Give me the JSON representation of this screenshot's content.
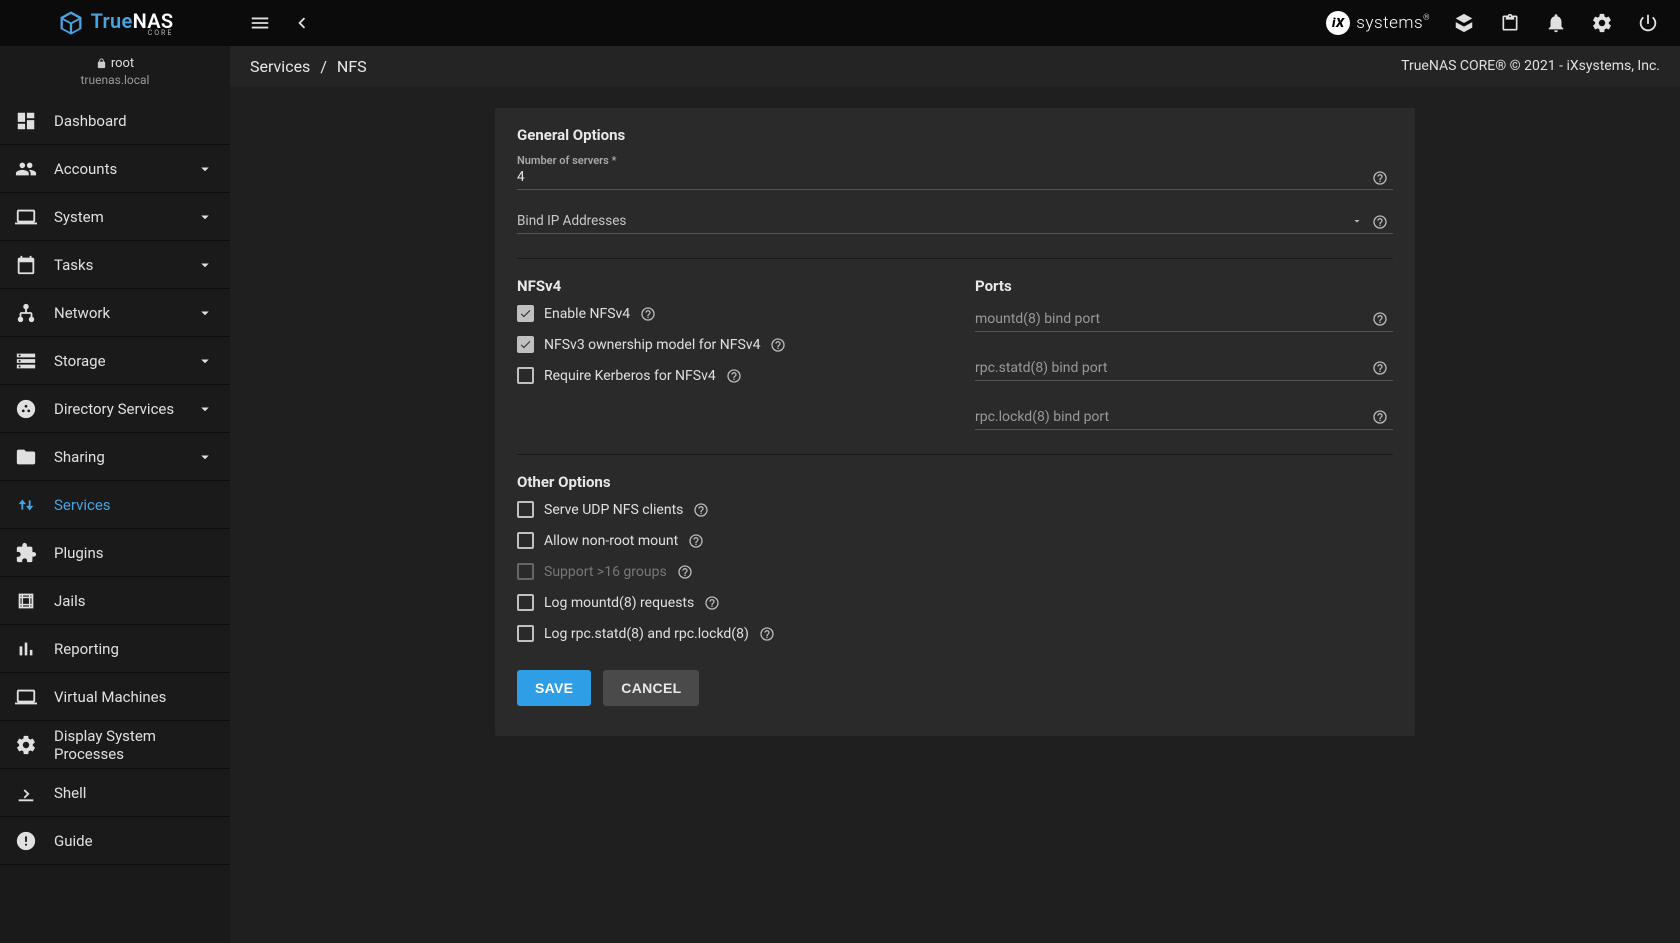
{
  "brand": {
    "true": "True",
    "nas": "NAS",
    "core": "CORE"
  },
  "user": {
    "name": "root",
    "host": "truenas.local"
  },
  "topbar": {
    "ixsystems": "systems"
  },
  "breadcrumb": {
    "services": "Services",
    "sep": "/",
    "nfs": "NFS",
    "copyright": "TrueNAS CORE® © 2021 - iXsystems, Inc."
  },
  "sidebar": {
    "items": [
      {
        "label": "Dashboard",
        "expandable": false
      },
      {
        "label": "Accounts",
        "expandable": true
      },
      {
        "label": "System",
        "expandable": true
      },
      {
        "label": "Tasks",
        "expandable": true
      },
      {
        "label": "Network",
        "expandable": true
      },
      {
        "label": "Storage",
        "expandable": true
      },
      {
        "label": "Directory Services",
        "expandable": true
      },
      {
        "label": "Sharing",
        "expandable": true
      },
      {
        "label": "Services",
        "expandable": false,
        "active": true
      },
      {
        "label": "Plugins",
        "expandable": false
      },
      {
        "label": "Jails",
        "expandable": false
      },
      {
        "label": "Reporting",
        "expandable": false
      },
      {
        "label": "Virtual Machines",
        "expandable": false
      },
      {
        "label": "Display System Processes",
        "expandable": false
      },
      {
        "label": "Shell",
        "expandable": false
      },
      {
        "label": "Guide",
        "expandable": false
      }
    ]
  },
  "form": {
    "general": {
      "title": "General Options",
      "num_servers_label": "Number of servers *",
      "num_servers_value": "4",
      "bind_ip_label": "Bind IP Addresses"
    },
    "nfsv4": {
      "title": "NFSv4",
      "enable": "Enable NFSv4",
      "ownership": "NFSv3 ownership model for NFSv4",
      "kerberos": "Require Kerberos for NFSv4"
    },
    "ports": {
      "title": "Ports",
      "mountd": "mountd(8) bind port",
      "statd": "rpc.statd(8) bind port",
      "lockd": "rpc.lockd(8) bind port"
    },
    "other": {
      "title": "Other Options",
      "udp": "Serve UDP NFS clients",
      "nonroot": "Allow non-root mount",
      "groups16": "Support >16 groups",
      "logmountd": "Log mountd(8) requests",
      "logrpc": "Log rpc.statd(8) and rpc.lockd(8)"
    },
    "actions": {
      "save": "SAVE",
      "cancel": "CANCEL"
    }
  }
}
